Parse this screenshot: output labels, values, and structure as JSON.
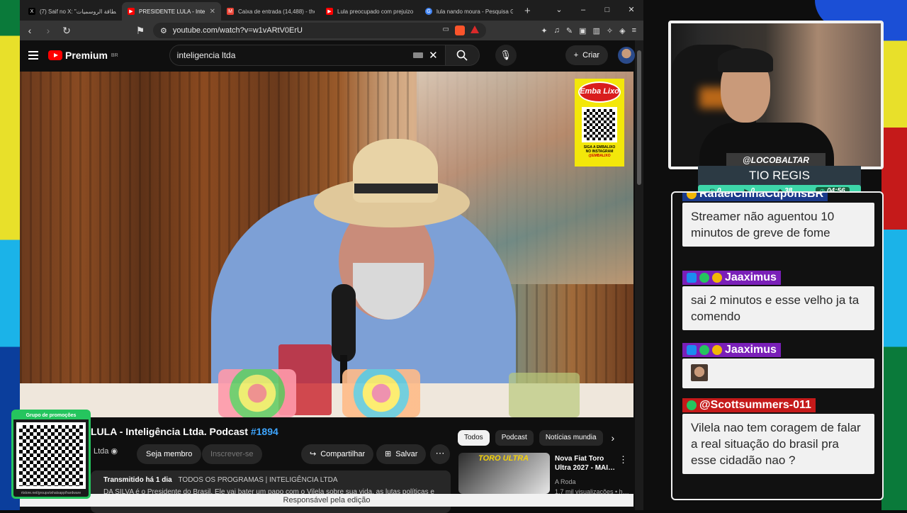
{
  "browser": {
    "tabs": [
      {
        "label": "(7) Saif no X: \"بطاقة الروسميات …",
        "icon": "x-logo-icon",
        "color": "#000000"
      },
      {
        "label": "PRESIDENTE LULA - Inte…",
        "icon": "youtube-icon",
        "color": "#ff0000",
        "active": true
      },
      {
        "label": "Caixa de entrada (14,488) - theb…",
        "icon": "gmail-icon",
        "color": "#ea4335"
      },
      {
        "label": "Lula preocupado com prejuizo e…",
        "icon": "youtube-icon",
        "color": "#ff0000"
      },
      {
        "label": "lula nando moura - Pesquisa Go…",
        "icon": "google-icon",
        "color": "#4285f4"
      }
    ],
    "new_tab": "+",
    "url": "youtube.com/watch?v=w1vARtV0ErU",
    "window_controls": [
      "⌄",
      "–",
      "□",
      "✕"
    ]
  },
  "youtube": {
    "logo": "Premium",
    "logo_region": "BR",
    "search_value": "inteligencia ltda",
    "criar_label": "Criar",
    "ad": {
      "brand": "Emba Lixo",
      "line1": "SIGA A EMBALIXO",
      "line2": "NO INSTAGRAM",
      "handle": "@EMBALIXO"
    },
    "video_title": "LULA - Inteligência Ltda. Podcast",
    "video_hashtag": "#1894",
    "channel": "Ltda",
    "seja_membro": "Seja membro",
    "inscrever": "Inscrever-se",
    "compartilhar": "Compartilhar",
    "salvar": "Salvar",
    "desc_meta": "Transmitido há 1 dia",
    "desc_tags": "TODOS OS PROGRAMAS | INTELIGÊNCIA LTDA",
    "desc_text": "DA SILVA é o Presidente do Brasil. Ele vai bater um papo com o Vilela sobre sua vida, as lutas políticas e",
    "chips": [
      "Todos",
      "Podcast",
      "Notícias mundia"
    ],
    "rec": {
      "thumb_text": "TORO ULTRA",
      "title": "Nova Fiat Toro Ultra 2027 - MAI…",
      "channel": "A Roda",
      "views": "1,7 mil visualizações • h…"
    },
    "footer": "Responsável pela edição"
  },
  "overlay": {
    "promo_header": "Grupo de promoções",
    "promo_footer": "rtstore.net/groups/whatsapp/hardware",
    "handle": "@LOCOBALTAR",
    "streamer_name": "TIO REGIS",
    "stats": [
      "0",
      "0",
      "38",
      "04:56"
    ]
  },
  "chat": {
    "messages": [
      {
        "user": "RafaelCinnaCuponsBR",
        "text": "Streamer não aguentou 10 minutos de greve de fome",
        "user_color": "#1b3a8a"
      },
      {
        "user": "Jaaximus",
        "text": "sai 2 minutos e esse velho ja ta comendo",
        "user_color": "#7a1fb8"
      },
      {
        "user": "Jaaximus",
        "text": "",
        "user_color": "#7a1fb8"
      },
      {
        "user": "@Scottsummers-011",
        "text": "Vilela nao tem coragem de falar a real situação do brasil pra esse cidadão nao ?",
        "user_color": "#c51a1a"
      }
    ]
  }
}
